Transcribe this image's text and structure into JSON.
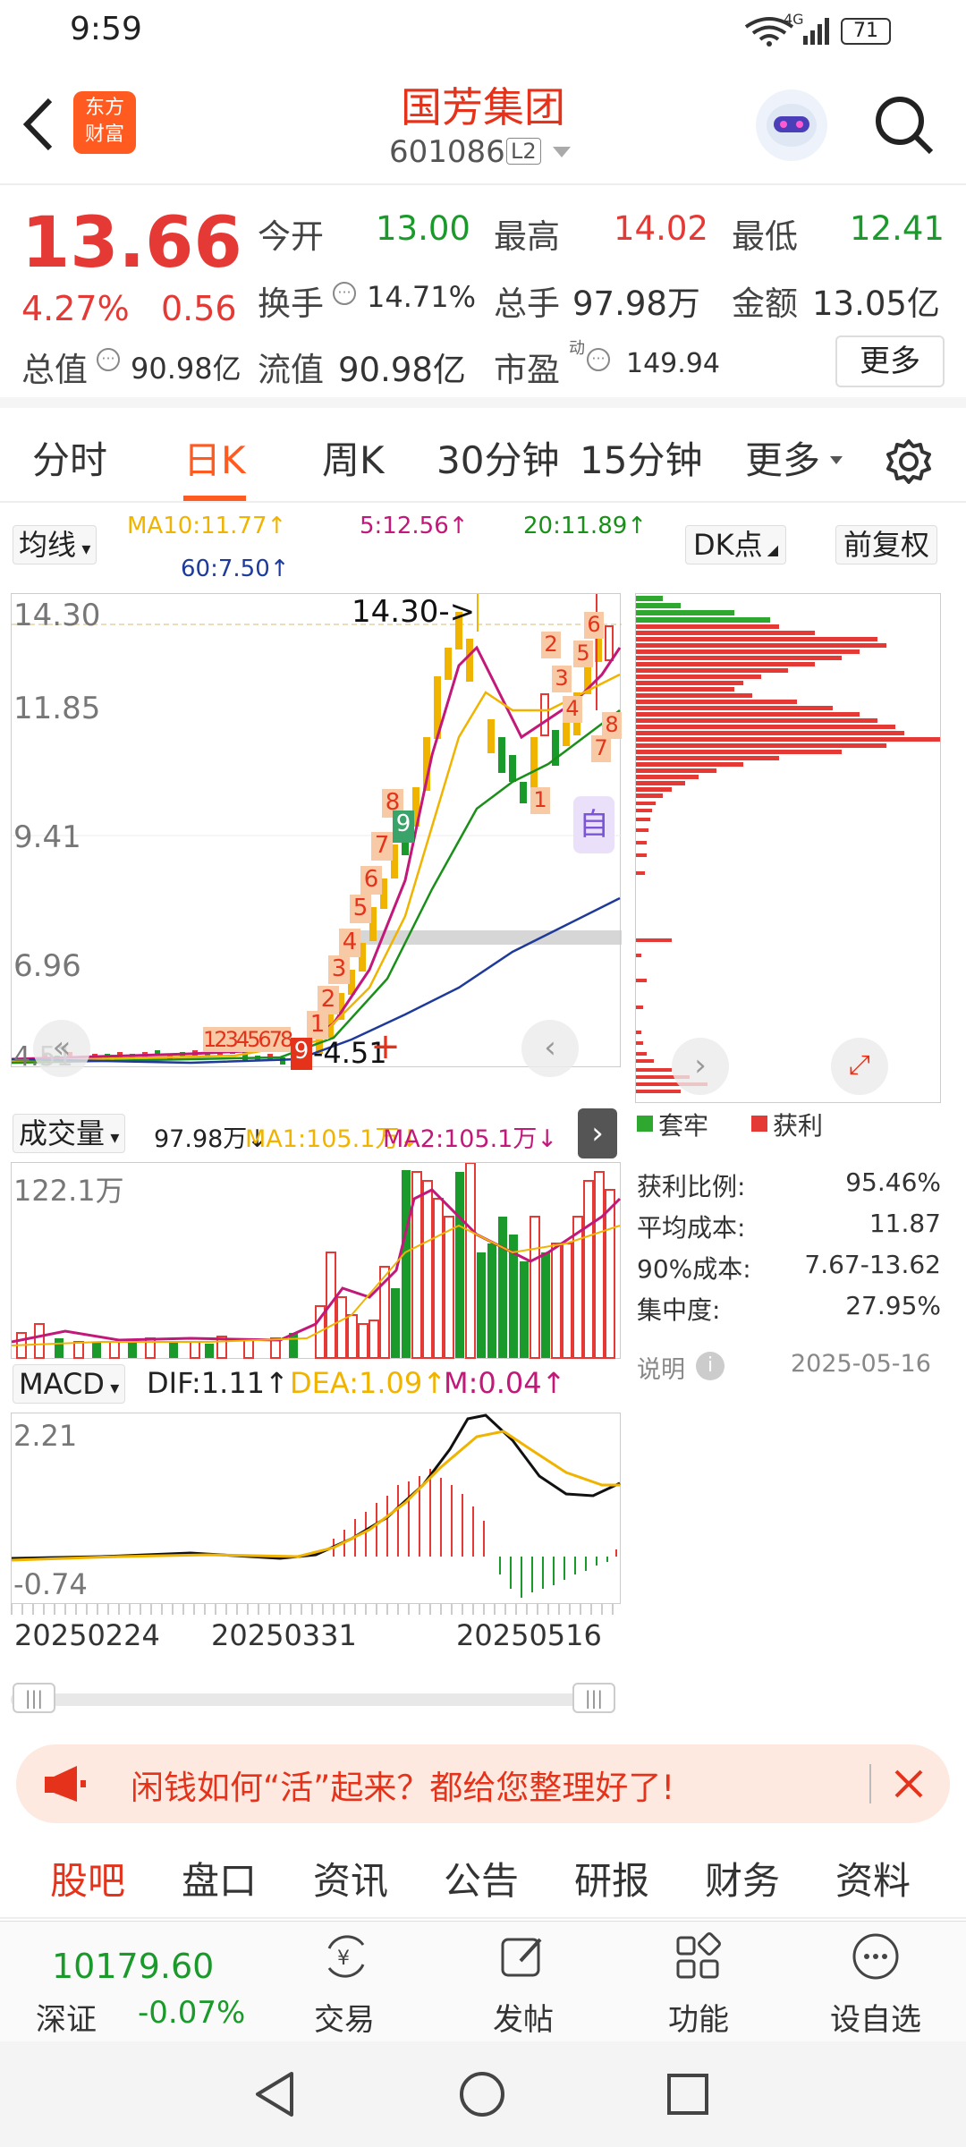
{
  "status": {
    "time": "9:59",
    "battery": "71",
    "network": "4G"
  },
  "header": {
    "app_logo_line1": "东方",
    "app_logo_line2": "财富",
    "stock_name": "国芳集团",
    "stock_code": "601086",
    "level_badge": "L2"
  },
  "quote": {
    "price": "13.66",
    "change_pct": "4.27%",
    "change_amt": "0.56",
    "open_label": "今开",
    "open": "13.00",
    "high_label": "最高",
    "high": "14.02",
    "low_label": "最低",
    "low": "12.41",
    "turnover_label": "换手",
    "turnover": "14.71%",
    "volume_label": "总手",
    "volume": "97.98万",
    "amount_label": "金额",
    "amount": "13.05亿",
    "mktcap_label": "总值",
    "mktcap": "90.98亿",
    "float_label": "流值",
    "float": "90.98亿",
    "pe_label": "市盈",
    "pe_sup": "动",
    "pe": "149.94",
    "more_button": "更多"
  },
  "period_tabs": {
    "t1": "分时",
    "t2": "日K",
    "t3": "周K",
    "t4": "30分钟",
    "t5": "15分钟",
    "t6": "更多"
  },
  "kline": {
    "ma_selector": "均线",
    "ma10": "MA10:11.77↑",
    "ma5": "5:12.56↑",
    "ma20": "20:11.89↑",
    "ma60": "60:7.50↑",
    "dk_button": "DK点",
    "adjust_button": "前复权",
    "y_labels": [
      "14.30",
      "11.85",
      "9.41",
      "6.96",
      "4.51"
    ],
    "max_marker": "14.30->",
    "min_marker": "<-4.51",
    "td_up": [
      "1",
      "2",
      "3",
      "4",
      "5",
      "6",
      "7",
      "8",
      "9"
    ],
    "td_low": [
      "1",
      "2",
      "3",
      "4",
      "5",
      "6",
      "7",
      "8",
      "9"
    ],
    "td_top": [
      "1",
      "2",
      "3",
      "4",
      "5",
      "6",
      "7"
    ],
    "td_last": "8",
    "side_tag": "自"
  },
  "volume": {
    "selector": "成交量",
    "vol": "97.98万↓",
    "ma1": "MA1:105.1万↓",
    "ma2": "MA2:105.1万↓",
    "max_label": "122.1万"
  },
  "macd": {
    "selector": "MACD",
    "dif": "DIF:1.11↑",
    "dea": "DEA:1.09↑",
    "m": "M:0.04↑",
    "top_label": "2.21",
    "bottom_label": "-0.74"
  },
  "dates": {
    "d1": "20250224",
    "d2": "20250331",
    "d3": "20250516"
  },
  "chip": {
    "legend_trapped": "套牢",
    "legend_profit": "获利",
    "rows": [
      {
        "label": "获利比例:",
        "value": "95.46%"
      },
      {
        "label": "平均成本:",
        "value": "11.87"
      },
      {
        "label": "90%成本:",
        "value": "7.67-13.62"
      },
      {
        "label": "集中度:",
        "value": "27.95%"
      }
    ],
    "note_label": "说明",
    "date": "2025-05-16"
  },
  "banner": {
    "text": "闲钱如何“活”起来？都给您整理好了!"
  },
  "bottom_tabs": {
    "t1": "股吧",
    "t2": "盘口",
    "t3": "资讯",
    "t4": "公告",
    "t5": "研报",
    "t6": "财务",
    "t7": "资料"
  },
  "bottom_bar": {
    "index_value": "10179.60",
    "index_name": "深证",
    "index_change": "-0.07%",
    "trade": "交易",
    "post": "发帖",
    "feature": "功能",
    "watchlist": "设自选"
  },
  "colors": {
    "brand": "#ff5a1f",
    "up": "#e53935",
    "down": "#1a9a2a",
    "ma5": "#c2187a",
    "ma10": "#f0b400",
    "ma20": "#1a8f1a",
    "ma60": "#1e3a9a"
  }
}
